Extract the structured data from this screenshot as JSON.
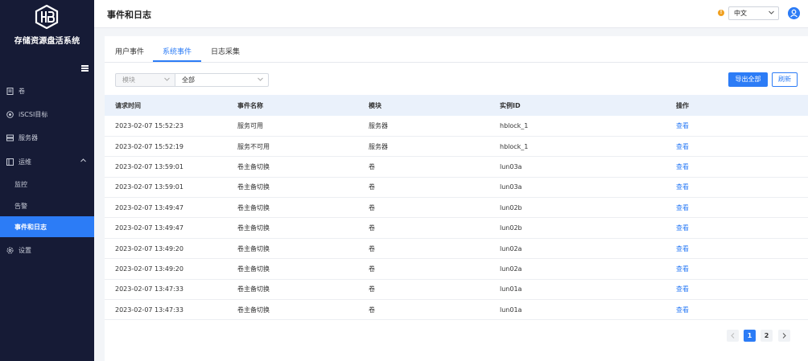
{
  "app": {
    "title": "存储资源盘活系统"
  },
  "sidebar": {
    "items": [
      {
        "label": "卷",
        "icon": "document-icon"
      },
      {
        "label": "iSCSI目标",
        "icon": "target-icon"
      },
      {
        "label": "服务器",
        "icon": "server-icon"
      },
      {
        "label": "运维",
        "icon": "ops-icon"
      },
      {
        "label": "监控"
      },
      {
        "label": "告警"
      },
      {
        "label": "事件和日志"
      },
      {
        "label": "设置",
        "icon": "gear-icon"
      }
    ]
  },
  "header": {
    "title": "事件和日志",
    "language": "中文"
  },
  "tabs": [
    {
      "label": "用户事件"
    },
    {
      "label": "系统事件"
    },
    {
      "label": "日志采集"
    }
  ],
  "filter": {
    "field": "模块",
    "value": "全部"
  },
  "toolbar": {
    "export_label": "导出全部",
    "refresh_label": "刷新"
  },
  "table": {
    "headers": [
      "请求时间",
      "事件名称",
      "模块",
      "实例ID",
      "操作"
    ],
    "rows": [
      {
        "time": "2023-02-07 15:52:23",
        "event": "服务可用",
        "module": "服务器",
        "instance": "hblock_1",
        "action": "查看"
      },
      {
        "time": "2023-02-07 15:52:19",
        "event": "服务不可用",
        "module": "服务器",
        "instance": "hblock_1",
        "action": "查看"
      },
      {
        "time": "2023-02-07 13:59:01",
        "event": "卷主备切换",
        "module": "卷",
        "instance": "lun03a",
        "action": "查看"
      },
      {
        "time": "2023-02-07 13:59:01",
        "event": "卷主备切换",
        "module": "卷",
        "instance": "lun03a",
        "action": "查看"
      },
      {
        "time": "2023-02-07 13:49:47",
        "event": "卷主备切换",
        "module": "卷",
        "instance": "lun02b",
        "action": "查看"
      },
      {
        "time": "2023-02-07 13:49:47",
        "event": "卷主备切换",
        "module": "卷",
        "instance": "lun02b",
        "action": "查看"
      },
      {
        "time": "2023-02-07 13:49:20",
        "event": "卷主备切换",
        "module": "卷",
        "instance": "lun02a",
        "action": "查看"
      },
      {
        "time": "2023-02-07 13:49:20",
        "event": "卷主备切换",
        "module": "卷",
        "instance": "lun02a",
        "action": "查看"
      },
      {
        "time": "2023-02-07 13:47:33",
        "event": "卷主备切换",
        "module": "卷",
        "instance": "lun01a",
        "action": "查看"
      },
      {
        "time": "2023-02-07 13:47:33",
        "event": "卷主备切换",
        "module": "卷",
        "instance": "lun01a",
        "action": "查看"
      }
    ]
  },
  "pagination": {
    "pages": [
      "1",
      "2"
    ],
    "current": "1"
  },
  "colors": {
    "sidebar": "#161b36",
    "accent": "#2c7cf6",
    "warning": "#f0a020"
  }
}
